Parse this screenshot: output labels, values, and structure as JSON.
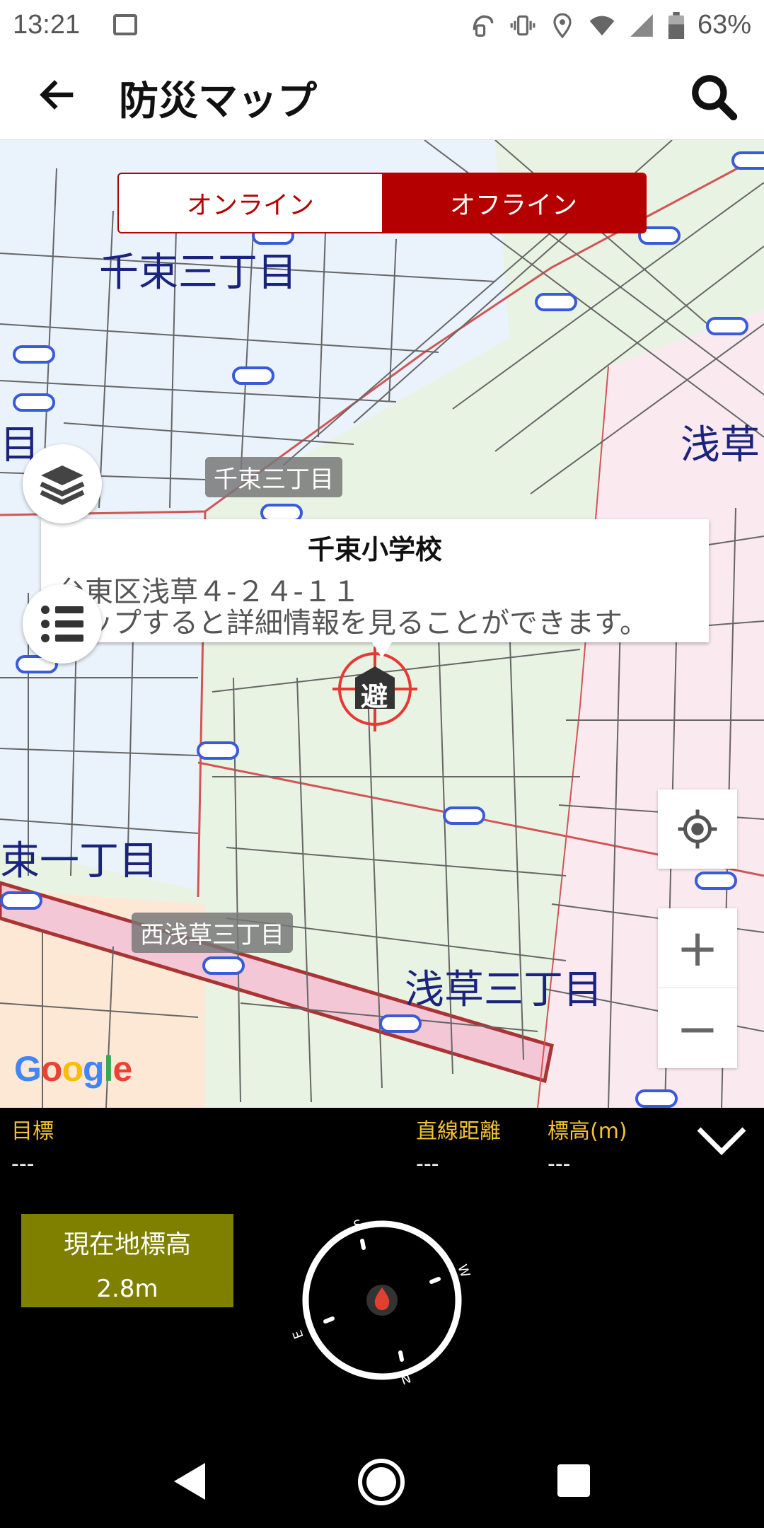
{
  "status_bar": {
    "time": "13:21",
    "battery": "63%"
  },
  "app_bar": {
    "title": "防災マップ"
  },
  "map_toggle": {
    "online": "オンライン",
    "offline": "オフライン"
  },
  "map_labels": {
    "area_1": "千束三丁目",
    "area_2": "浅草",
    "area_3": "千束三丁目",
    "area_4": "束一丁目",
    "area_5": "西浅草三丁目",
    "area_6": "浅草三丁目",
    "area_7": "目"
  },
  "info_window": {
    "name": "千束小学校",
    "address": "台東区浅草４-２４-１１",
    "hint": "タップすると詳細情報を見ることができます。"
  },
  "shelter_marker": {
    "label": "避"
  },
  "google_logo": "Google",
  "zoom": {
    "plus": "+",
    "minus": "−"
  },
  "panel": {
    "target_label": "目標",
    "target_value": "---",
    "distance_label": "直線距離",
    "distance_value": "---",
    "elevation_label": "標高(m)",
    "elevation_value": "---",
    "current_elev_title": "現在地標高",
    "current_elev_value": "2.8m"
  },
  "compass": {
    "s": "S",
    "w": "W",
    "n": "N",
    "e": "E"
  },
  "colors": {
    "accent": "#b50000",
    "label_yellow": "#f2c230",
    "elev_box": "#808000"
  }
}
